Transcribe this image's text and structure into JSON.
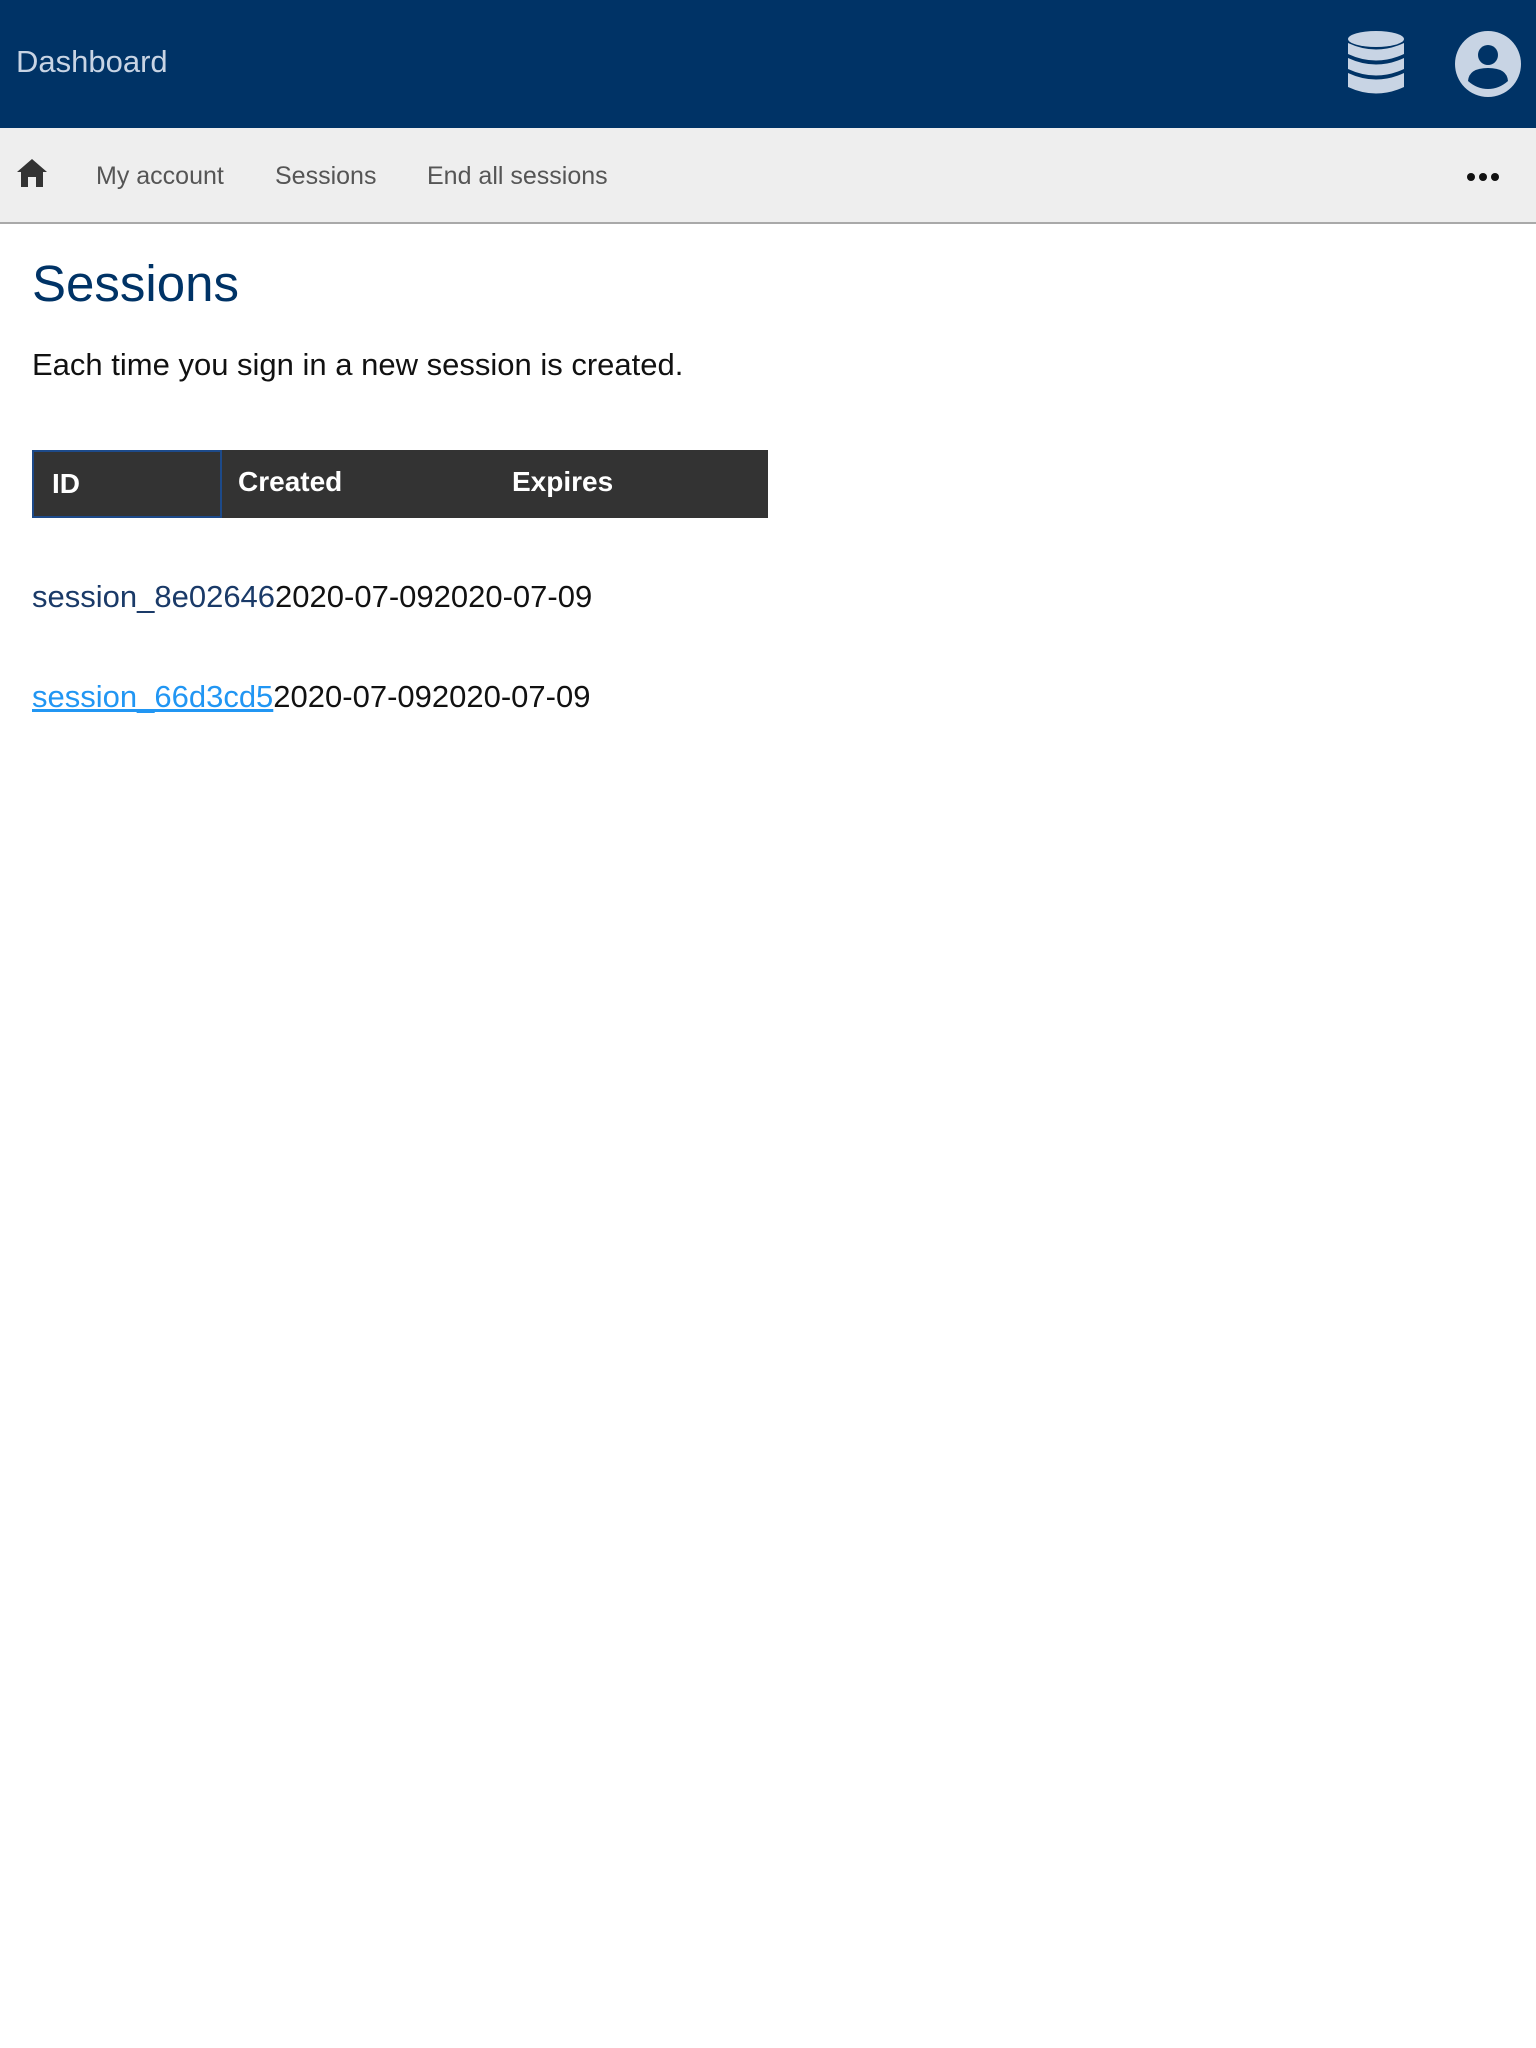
{
  "header": {
    "title": "Dashboard",
    "icons": [
      "database-icon",
      "user-account-icon"
    ],
    "background_color": "#003366"
  },
  "nav": {
    "home_icon": "home-icon",
    "items": [
      {
        "label": "My account"
      },
      {
        "label": "Sessions"
      },
      {
        "label": "End all sessions"
      }
    ],
    "more_icon": "more-horizontal-icon"
  },
  "page": {
    "title": "Sessions",
    "description": "Each time you sign in a new session is created."
  },
  "table": {
    "columns": [
      "ID",
      "Created",
      "Expires"
    ],
    "rows": [
      {
        "id": "session_8e02646",
        "created": "2020-07-09",
        "expires": "2020-07-09"
      },
      {
        "id": "session_66d3cd5",
        "created": "2020-07-09",
        "expires": "2020-07-09"
      }
    ]
  },
  "colors": {
    "accent": "#003366",
    "link_hover": "#2196f3",
    "table_header": "#333333"
  }
}
